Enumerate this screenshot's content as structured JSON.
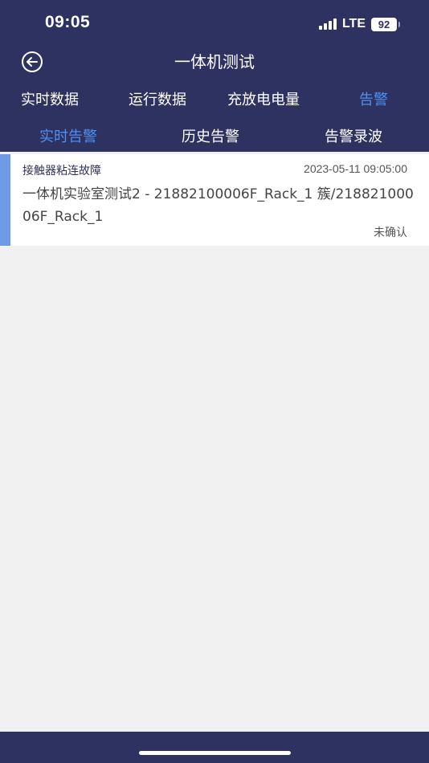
{
  "status_bar": {
    "time": "09:05",
    "network": "LTE",
    "battery": "92"
  },
  "header": {
    "title": "一体机测试",
    "back_icon": "back-arrow-circle-icon"
  },
  "tabs": [
    {
      "label": "实时数据",
      "active": false
    },
    {
      "label": "运行数据",
      "active": false
    },
    {
      "label": "充放电电量",
      "active": false
    },
    {
      "label": "告警",
      "active": true
    }
  ],
  "subtabs": [
    {
      "label": "实时告警",
      "active": true
    },
    {
      "label": "历史告警",
      "active": false
    },
    {
      "label": "告警录波",
      "active": false
    }
  ],
  "alarms": [
    {
      "name": "接触器粘连故障",
      "time": "2023-05-11 09:05:00",
      "description": "一体机实验室测试2 - 21882100006F_Rack_1 簇/21882100006F_Rack_1",
      "status": "未确认"
    }
  ],
  "colors": {
    "header_bg": "#2e3260",
    "accent": "#4f8ff0",
    "alarm_bar": "#6f9be6"
  }
}
